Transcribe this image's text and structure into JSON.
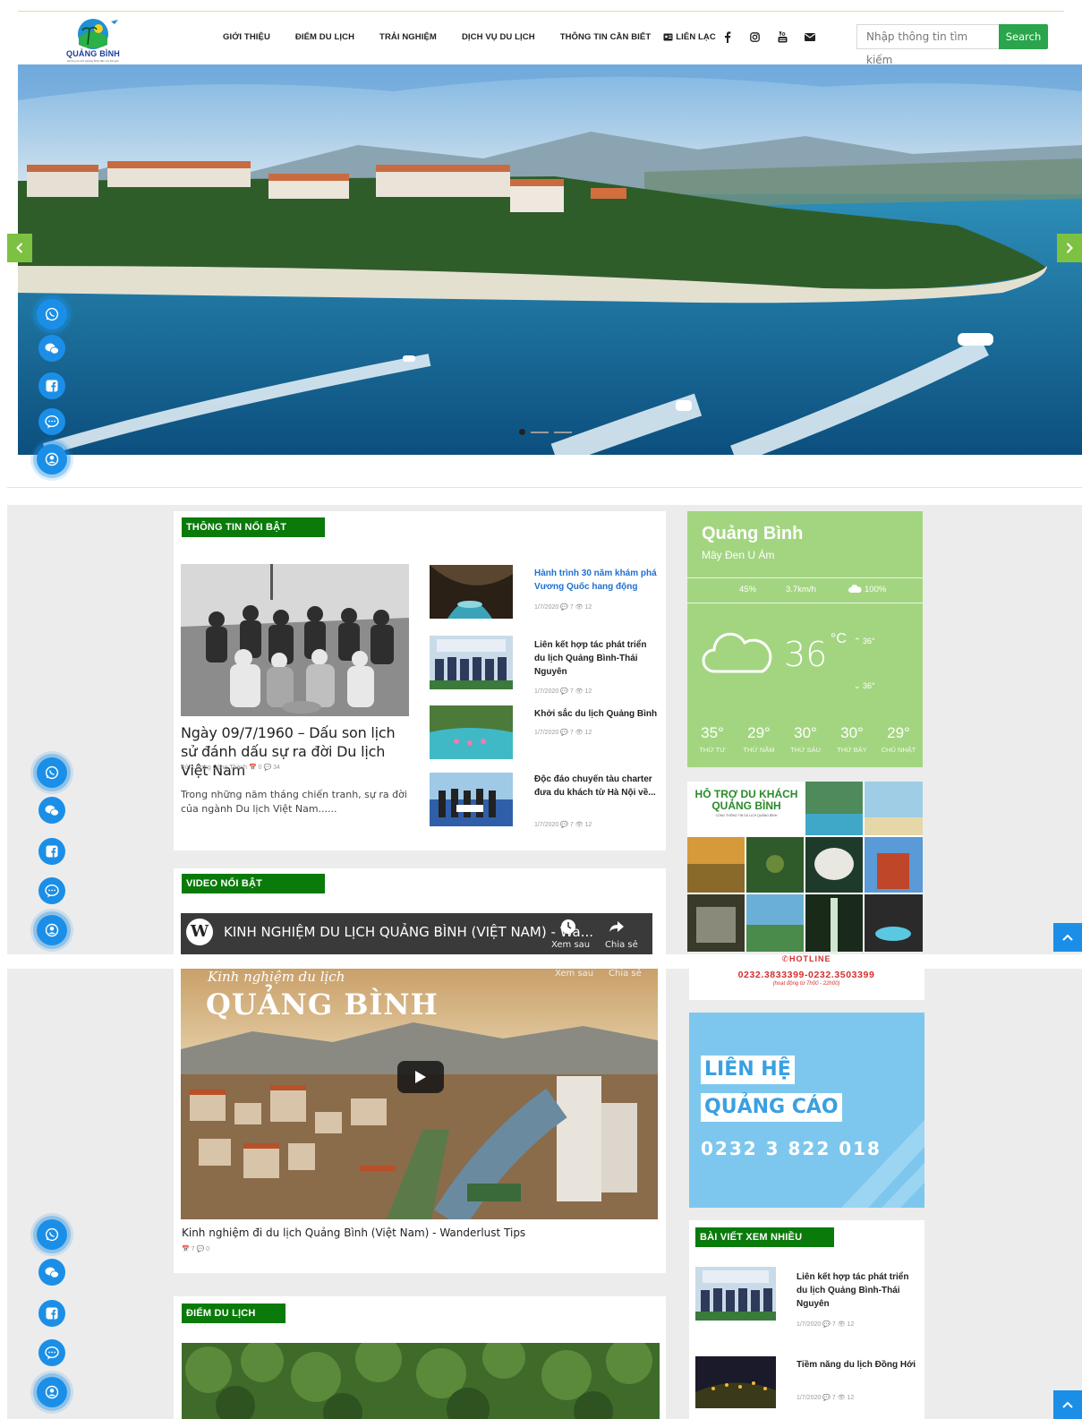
{
  "header": {
    "logo_text": "QUẢNG BÌNH",
    "logo_subtext": "Đường du lịch Quảng Bình đến với thế giới",
    "nav": [
      "GIỚI THIỆU",
      "ĐIỂM DU LỊCH",
      "TRẢI NGHIỆM",
      "DỊCH VỤ DU LỊCH",
      "THÔNG TIN CẦN BIẾT"
    ],
    "contact_label": "LIÊN LẠC",
    "social_icons": [
      "facebook-icon",
      "instagram-icon",
      "youtube-icon",
      "mail-icon"
    ],
    "search_placeholder": "Nhập thông tin tìm kiếm",
    "search_button": "Search"
  },
  "featured": {
    "section_title": "THÔNG TIN NỔI BẬT",
    "main": {
      "title": "Ngày 09/7/1960 – Dấu son lịch sử đánh dấu sự ra đời Du lịch Việt Nam",
      "meta": "Bởi Lương Công Thành 📅 0 💬 34",
      "excerpt": "Trong những năm tháng chiến tranh, sự ra đời của ngành Du lịch Việt Nam......"
    },
    "items": [
      {
        "title": "Hành trình 30 năm khám phá Vương Quốc hang động",
        "meta": "1/7/2020 💬 7 👁 12"
      },
      {
        "title": "Liên kết hợp tác phát triển du lịch Quảng Bình-Thái Nguyên",
        "meta": "1/7/2020 💬 7 👁 12"
      },
      {
        "title": "Khởi sắc du lịch Quảng Bình",
        "meta": "1/7/2020 💬 7 👁 12"
      },
      {
        "title": "Độc đáo chuyến tàu charter đưa du khách từ Hà Nội về...",
        "meta": "1/7/2020 💬 7 👁 12"
      }
    ]
  },
  "weather": {
    "city": "Quảng Bình",
    "desc": "Mây Đen U Ám",
    "humidity": "45%",
    "wind": "3.7km/h",
    "cloud": "100%",
    "temp": "36",
    "unit": "°C",
    "high": "36°",
    "low": "36°",
    "forecast": [
      {
        "t": "35°",
        "d": "THỨ TƯ"
      },
      {
        "t": "29°",
        "d": "THỨ NĂM"
      },
      {
        "t": "30°",
        "d": "THỨ SÁU"
      },
      {
        "t": "30°",
        "d": "THỨ BẢY"
      },
      {
        "t": "29°",
        "d": "CHỦ NHẬT"
      }
    ]
  },
  "support": {
    "title1": "HỖ TRỢ DU KHÁCH",
    "title2": "QUẢNG BÌNH",
    "sub": "CỔNG THÔNG TIN DU LỊCH QUẢNG BÌNH",
    "hotline_label": "HOTLINE",
    "hotline": "0232.3833399-0232.3503399",
    "hours": "(hoạt động từ 7h00 - 22h00)"
  },
  "video": {
    "section_title": "VIDEO NỔI BẬT",
    "bar_title": "KINH NGHIỆM DU LỊCH QUẢNG BÌNH (VIỆT NAM) - Wa...",
    "watch_later": "Xem sau",
    "share": "Chia sẻ",
    "channel": "wanderlust",
    "overlay_small": "Kinh nghiệm du lịch",
    "overlay_big": "QUẢNG BÌNH",
    "caption": "Kinh nghiệm đi du lịch Quảng Bình (Việt Nam) - Wanderlust Tips",
    "meta": "📅 7 💬 0"
  },
  "ad": {
    "line1": "LIÊN HỆ",
    "line2": "QUẢNG CÁO",
    "phone": "0232 3 822 018"
  },
  "most_viewed": {
    "section_title": "BÀI VIẾT XEM NHIỀU",
    "items": [
      {
        "title": "Liên kết hợp tác phát triển du lịch Quảng Bình-Thái Nguyên",
        "meta": "1/7/2020 💬 7 👁 12"
      },
      {
        "title": "Tiềm năng du lịch Đồng Hới",
        "meta": "1/7/2020 💬 7 👁 12"
      }
    ]
  },
  "destinations": {
    "section_title": "ĐIỂM DU LỊCH"
  },
  "colors": {
    "green": "#0a7a0a",
    "search_green": "#2aa54b",
    "float_blue": "#1b8fe7",
    "weather_green": "#a3d581",
    "ad_blue": "#7dc7ee"
  }
}
